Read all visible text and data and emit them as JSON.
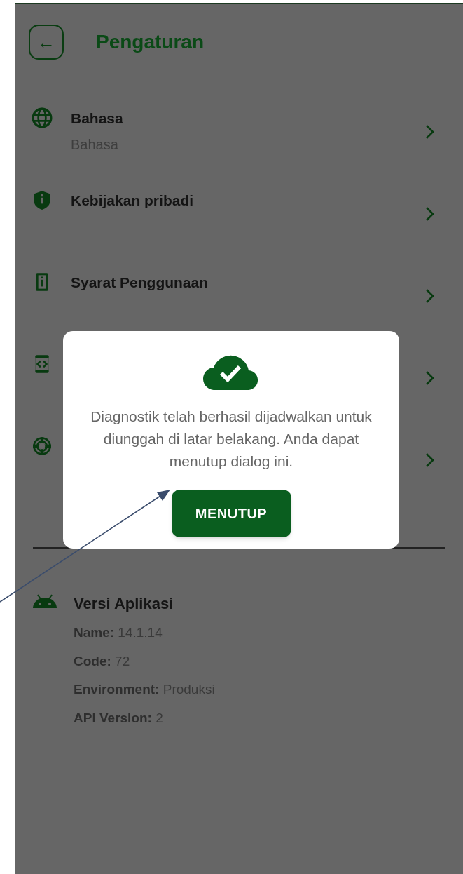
{
  "header": {
    "back_icon": "←",
    "title": "Pengaturan"
  },
  "items": [
    {
      "kind": "globe",
      "title": "Bahasa",
      "subtitle": "Bahasa"
    },
    {
      "kind": "shield",
      "title": "Kebijakan pribadi"
    },
    {
      "kind": "document",
      "title": "Syarat Penggunaan"
    },
    {
      "kind": "code"
    },
    {
      "kind": "lifebuoy"
    }
  ],
  "version": {
    "title": "Versi Aplikasi",
    "lines": [
      "**Name:** 14.1.14",
      "**Code:** 72",
      "**Environment:** Produksi",
      "**API Version:** 2"
    ]
  },
  "dialog": {
    "message": "Diagnostik telah berhasil dijadwalkan untuk diunggah di latar belakang. Anda dapat menutup dialog ini.",
    "button": "MENUTUP"
  }
}
